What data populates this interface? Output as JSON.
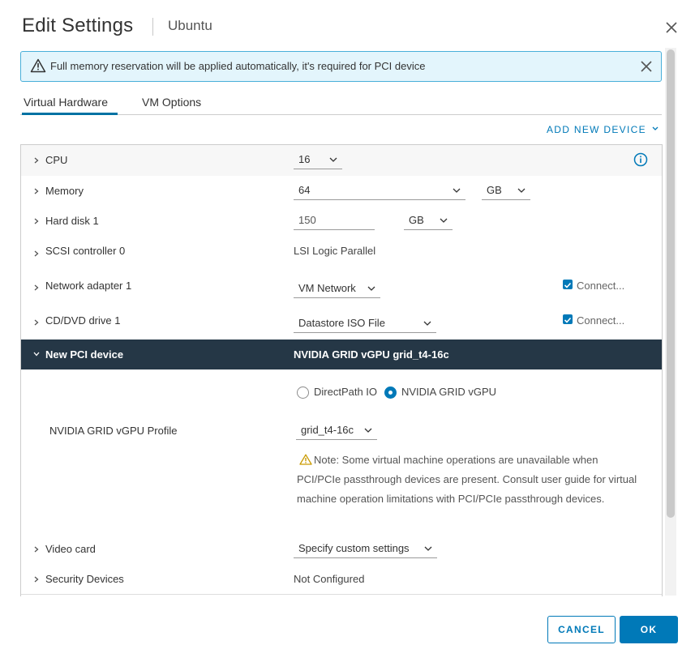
{
  "dialog": {
    "title": "Edit Settings",
    "subtitle": "Ubuntu"
  },
  "alert": {
    "text": "Full memory reservation will be applied automatically, it's required for PCI device"
  },
  "tabs": [
    {
      "label": "Virtual Hardware",
      "active": true
    },
    {
      "label": "VM Options",
      "active": false
    }
  ],
  "add_new_device": "ADD NEW DEVICE",
  "hardware": {
    "cpu": {
      "label": "CPU",
      "value": "16"
    },
    "memory": {
      "label": "Memory",
      "value": "64",
      "unit": "GB"
    },
    "hard_disk": {
      "label": "Hard disk 1",
      "value": "150",
      "unit": "GB"
    },
    "scsi": {
      "label": "SCSI controller 0",
      "value": "LSI Logic Parallel"
    },
    "network": {
      "label": "Network adapter 1",
      "value": "VM Network",
      "connect_label": "Connect...",
      "connected": true
    },
    "cddvd": {
      "label": "CD/DVD drive 1",
      "value": "Datastore ISO File",
      "connect_label": "Connect...",
      "connected": true
    },
    "pci": {
      "label": "New PCI device",
      "value": "NVIDIA GRID vGPU grid_t4-16c",
      "options": [
        "DirectPath IO",
        "NVIDIA GRID vGPU"
      ],
      "selected_option": "NVIDIA GRID vGPU",
      "profile_label": "NVIDIA GRID vGPU Profile",
      "profile_value": "grid_t4-16c",
      "note": "Note: Some virtual machine operations are unavailable when PCI/PCIe passthrough devices are present. Consult user guide for virtual machine operation limitations with PCI/PCIe passthrough devices."
    },
    "video": {
      "label": "Video card",
      "value": "Specify custom settings"
    },
    "security": {
      "label": "Security Devices",
      "value": "Not Configured"
    }
  },
  "buttons": {
    "cancel": "CANCEL",
    "ok": "OK"
  },
  "colors": {
    "accent": "#0079b8",
    "alert_bg": "#e3f5fc",
    "selected_row_bg": "#253746",
    "warning": "#c99a00"
  },
  "icons": [
    "close-icon",
    "warning-icon",
    "info-icon",
    "chevron-right-icon",
    "chevron-down-icon",
    "checkbox-checked-icon"
  ]
}
